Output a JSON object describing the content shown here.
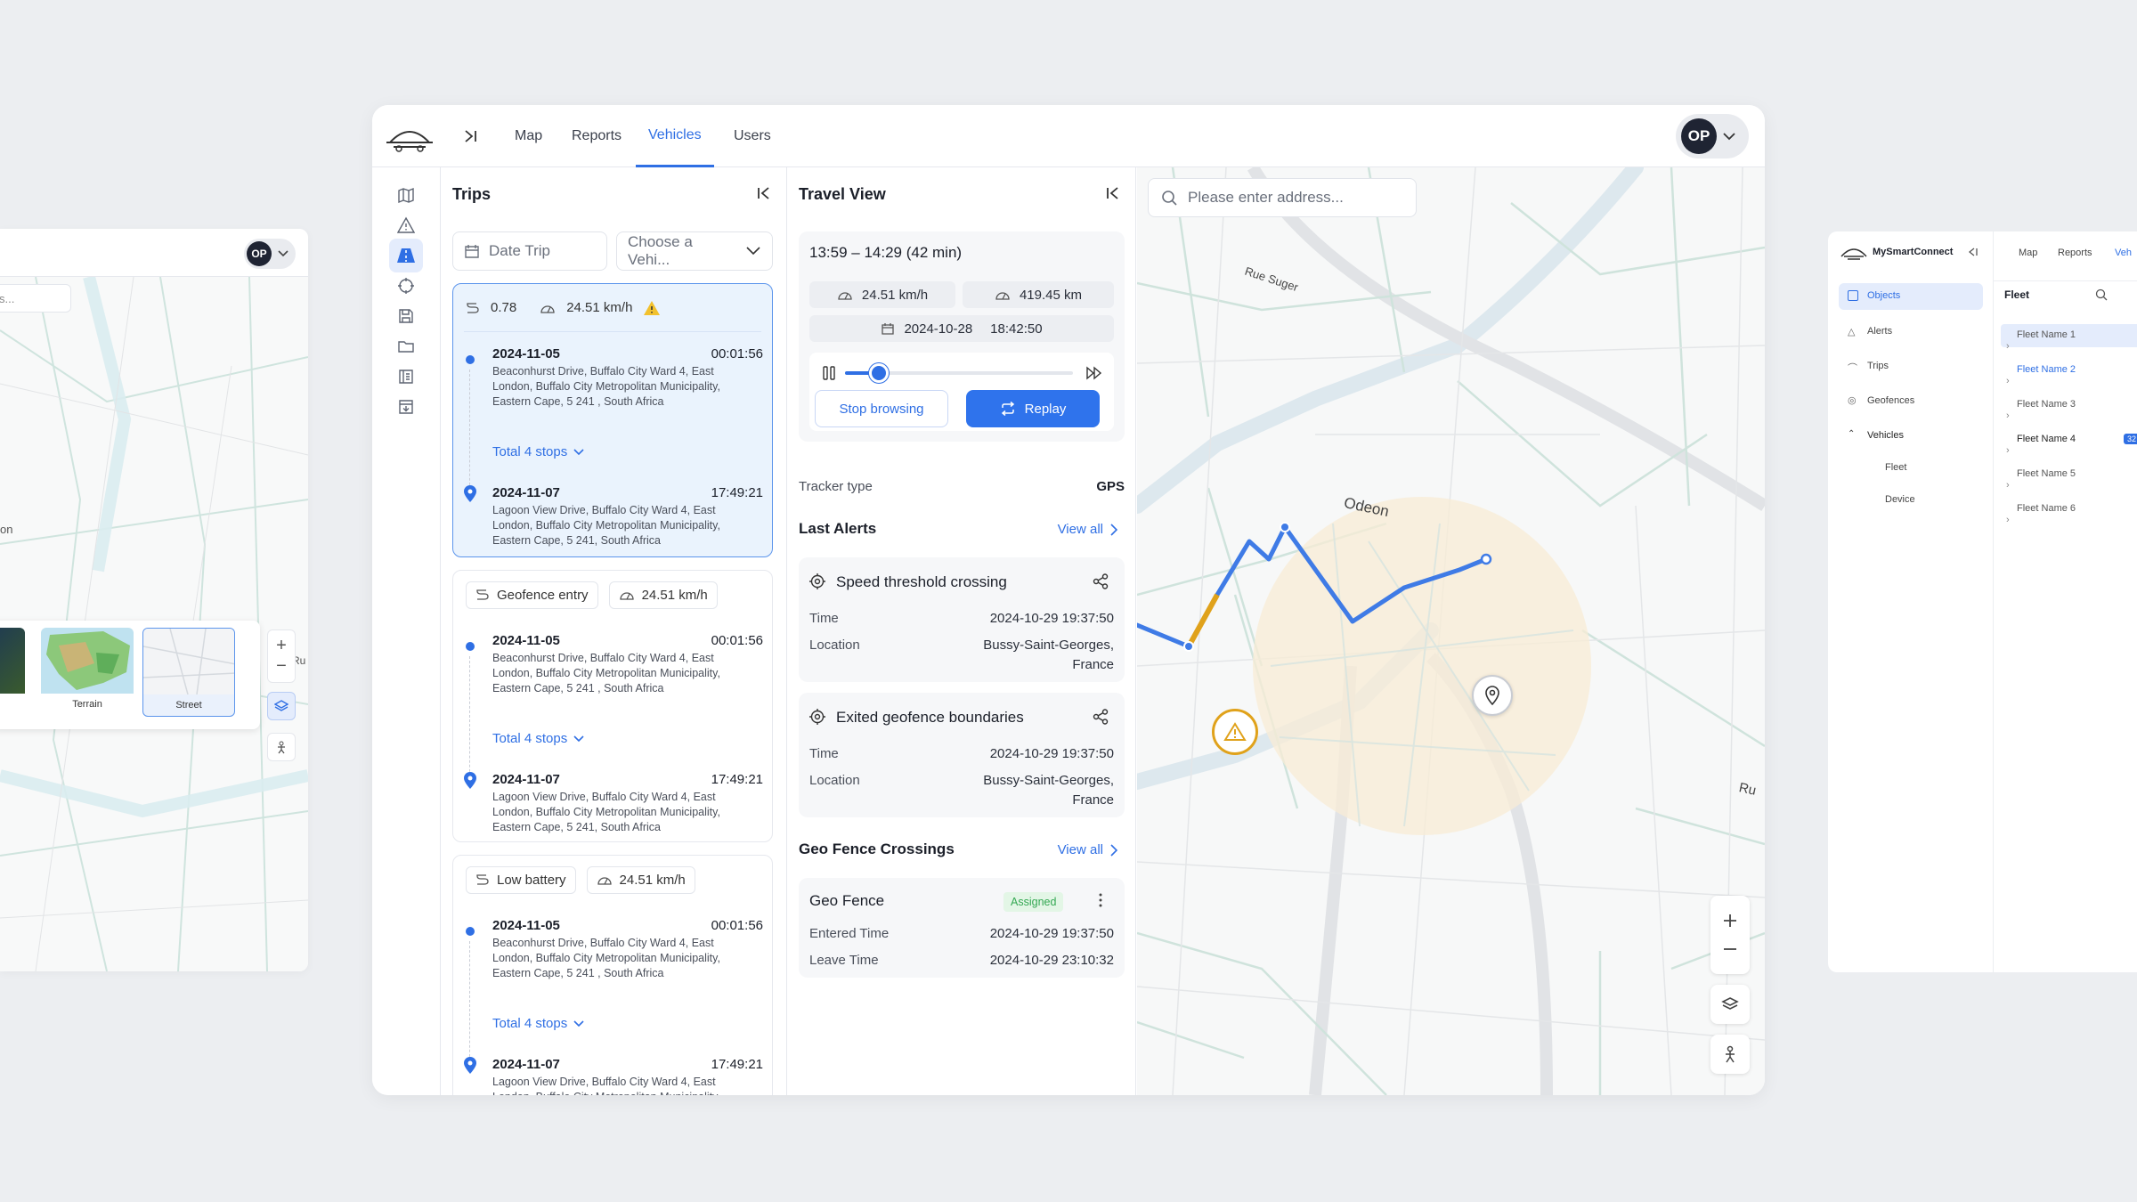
{
  "app": {
    "user_initials": "OP"
  },
  "nav": {
    "tabs": [
      "Map",
      "Reports",
      "Vehicles",
      "Users"
    ],
    "active_tab": "Vehicles"
  },
  "trips": {
    "title": "Trips",
    "date_placeholder": "Date Trip",
    "vehicle_placeholder": "Choose a Vehi...",
    "cards": [
      {
        "metric": "0.78",
        "speed": "24.51 km/h",
        "start_date": "2024-11-05",
        "start_time": "00:01:56",
        "start_address": "Beaconhurst Drive, Buffalo City Ward 4, East London, Buffalo City Metropolitan Municipality, Eastern Cape, 5 241 , South Africa",
        "stops": "Total 4 stops",
        "end_date": "2024-11-07",
        "end_time": "17:49:21",
        "end_address": "Lagoon View Drive, Buffalo City Ward 4, East London, Buffalo City Metropolitan Municipality, Eastern Cape, 5 241, South Africa"
      },
      {
        "metric": "Geofence entry",
        "speed": "24.51 km/h",
        "start_date": "2024-11-05",
        "start_time": "00:01:56",
        "start_address": "Beaconhurst Drive, Buffalo City Ward 4, East London, Buffalo City Metropolitan Municipality, Eastern Cape, 5 241 , South Africa",
        "stops": "Total 4 stops",
        "end_date": "2024-11-07",
        "end_time": "17:49:21",
        "end_address": "Lagoon View Drive, Buffalo City Ward 4, East London, Buffalo City Metropolitan Municipality, Eastern Cape, 5 241, South Africa"
      },
      {
        "metric": "Low battery",
        "speed": "24.51 km/h",
        "start_date": "2024-11-05",
        "start_time": "00:01:56",
        "start_address": "Beaconhurst Drive, Buffalo City Ward 4, East London, Buffalo City Metropolitan Municipality, Eastern Cape, 5 241 , South Africa",
        "stops": "Total 4 stops",
        "end_date": "2024-11-07",
        "end_time": "17:49:21",
        "end_address": "Lagoon View Drive, Buffalo City Ward 4, East London, Buffalo City Metropolitan Municipality"
      }
    ]
  },
  "travel": {
    "title": "Travel View",
    "time_range": "13:59 – 14:29 (42 min)",
    "speed": "24.51 km/h",
    "distance": "419.45 km",
    "date": "2024-10-28",
    "time": "18:42:50",
    "playback_progress": 0.15,
    "stop_label": "Stop browsing",
    "replay_label": "Replay",
    "tracker_label": "Tracker type",
    "tracker_value": "GPS",
    "alerts_title": "Last Alerts",
    "view_all": "View all",
    "alerts": [
      {
        "title": "Speed threshold crossing",
        "time_label": "Time",
        "time": "2024-10-29 19:37:50",
        "location_label": "Location",
        "location_line1": "Bussy-Saint-Georges,",
        "location_line2": "France"
      },
      {
        "title": "Exited geofence boundaries",
        "time_label": "Time",
        "time": "2024-10-29 19:37:50",
        "location_label": "Location",
        "location_line1": "Bussy-Saint-Georges,",
        "location_line2": "France"
      }
    ],
    "geo_title": "Geo Fence Crossings",
    "geo_card": {
      "name": "Geo Fence",
      "status": "Assigned",
      "entered_label": "Entered Time",
      "entered": "2024-10-29 19:37:50",
      "leave_label": "Leave Time",
      "leave": "2024-10-29 23:10:32"
    }
  },
  "map": {
    "search_placeholder": "Please enter address...",
    "street_labels": [
      "Rue Suger",
      "Odeon",
      "Ru"
    ]
  },
  "left_panel": {
    "search_placeholder": "s...",
    "street_label": "on",
    "street_label2": "Ru",
    "thumb_labels": [
      "Terrain",
      "Street"
    ]
  },
  "right_panel": {
    "brand": "MySmartConnect",
    "tabs": [
      "Map",
      "Reports",
      "Veh"
    ],
    "menu": [
      "Objects",
      "Alerts",
      "Trips",
      "Geofences",
      "Vehicles",
      "Fleet",
      "Device"
    ],
    "fleet_title": "Fleet",
    "fleets": [
      "Fleet Name 1",
      "Fleet Name 2",
      "Fleet Name 3",
      "Fleet Name 4",
      "Fleet Name 5",
      "Fleet Name 6"
    ],
    "fleet_badge": "32"
  },
  "colors": {
    "accent": "#2f6fe4",
    "warning": "#e0a21b",
    "geofence": "#f8ecd6",
    "route": "#3f7be6"
  }
}
